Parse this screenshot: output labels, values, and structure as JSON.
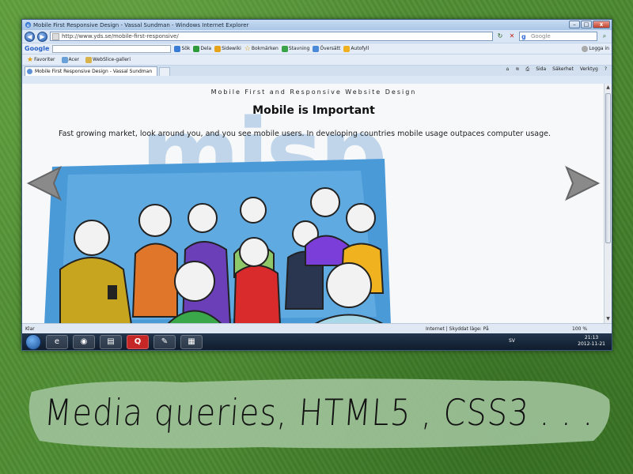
{
  "window": {
    "title": "Mobile First Responsive Design - Vassal Sundman - Windows Internet Explorer",
    "minimize": "–",
    "maximize": "□",
    "close": "x"
  },
  "addressbar": {
    "url": "http://www.yds.se/mobile-first-responsive/",
    "search_placeholder": "Google"
  },
  "google_toolbar": {
    "logo": "Google",
    "items": [
      "Sök",
      "Dela",
      "Sidewiki",
      "Bokmärken",
      "Stavning",
      "Översätt",
      "Autofyll"
    ],
    "login": "Logga in"
  },
  "favorites_bar": {
    "favorites": "Favoriter",
    "acer": "Acer",
    "webslice": "WebSlice-galleri"
  },
  "tabs": {
    "active": "Mobile First Responsive Design - Vassal Sundman",
    "commands": [
      "Sida",
      "Säkerhet",
      "Verktyg"
    ]
  },
  "page": {
    "site_title": "Mobile First and Responsive Website Design",
    "heading": "Mobile is Important",
    "intro": "Fast growing market, look around you, and you see mobile users. In developing countries mobile usage outpaces computer usage.",
    "watermark": "misp"
  },
  "statusbar": {
    "status": "Klar",
    "zone": "Internet | Skyddat läge: På",
    "zoom": "100 %"
  },
  "taskbar": {
    "language": "SV",
    "time": "21:13",
    "date": "2012-11-21"
  },
  "caption": "Media queries, HTML5 , CSS3  . . .",
  "colors": {
    "background_green": "#4f8a32",
    "caption_blob": "#9fc29a",
    "arrow_gray": "#8a8a8a"
  }
}
